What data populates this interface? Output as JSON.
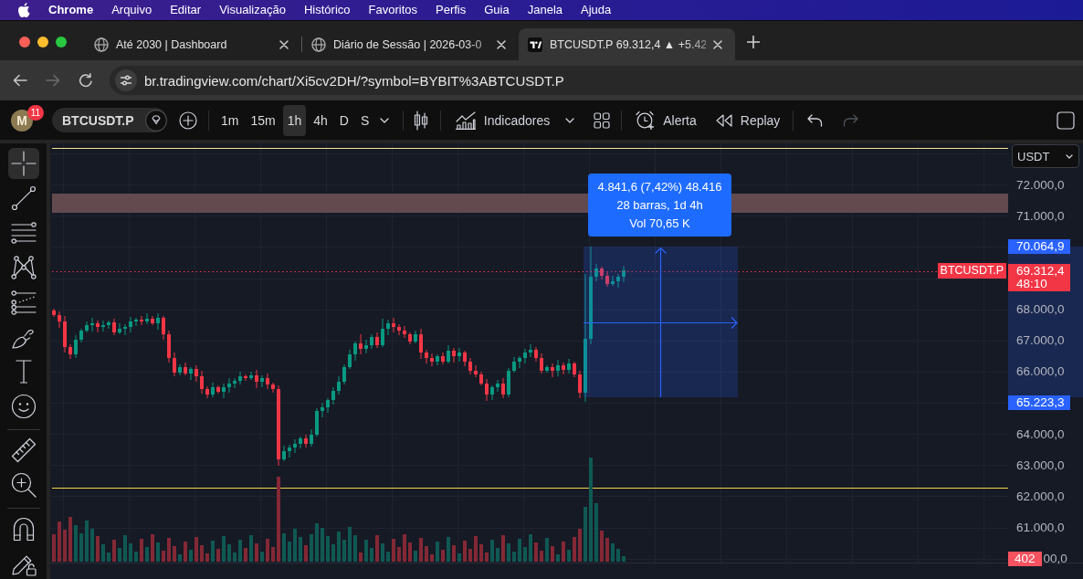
{
  "menu_bar": {
    "app_name": "Chrome",
    "items": [
      "Arquivo",
      "Editar",
      "Visualização",
      "Histórico",
      "Favoritos",
      "Perfis",
      "Guia",
      "Janela",
      "Ajuda"
    ]
  },
  "browser": {
    "tabs": [
      {
        "kind": "site",
        "title": "Até 2030 | Dashboard",
        "selected": false
      },
      {
        "kind": "site",
        "title": "Diário de Sessão | 2026-03-0",
        "selected": false
      },
      {
        "kind": "tradingview",
        "title": "BTCUSDT.P 69.312,4 ▲ +5.42",
        "selected": true
      }
    ],
    "nav_buttons": [
      {
        "kind": "back",
        "disabled": false
      },
      {
        "kind": "forward",
        "disabled": true
      },
      {
        "kind": "reload",
        "disabled": false
      }
    ],
    "address": "br.tradingview.com/chart/Xi5cv2DH/?symbol=BYBIT%3ABTCUSDT.P"
  },
  "top_toolbar": {
    "avatar": {
      "initial": "M",
      "badge": "11"
    },
    "symbol": "BTCUSDT.P",
    "intervals": [
      {
        "label": "1m",
        "selected": false
      },
      {
        "label": "15m",
        "selected": false
      },
      {
        "label": "1h",
        "selected": true
      },
      {
        "label": "4h",
        "selected": false
      },
      {
        "label": "D",
        "selected": false
      },
      {
        "label": "S",
        "selected": false
      }
    ],
    "items": [
      {
        "kind": "indicators",
        "label": "Indicadores"
      },
      {
        "kind": "alert",
        "label": "Alerta"
      },
      {
        "kind": "replay",
        "label": "Replay"
      }
    ],
    "history": [
      {
        "kind": "undo",
        "disabled": false
      },
      {
        "kind": "redo",
        "disabled": true
      }
    ]
  },
  "drawing_tools": [
    {
      "tools": [
        {
          "kind": "crosshair",
          "selected": true
        },
        {
          "kind": "trend_line",
          "selected": false
        },
        {
          "kind": "fib_lines",
          "selected": false
        },
        {
          "kind": "pattern",
          "selected": false
        },
        {
          "kind": "projection",
          "selected": false
        },
        {
          "kind": "brush",
          "selected": false
        },
        {
          "kind": "text",
          "selected": false
        },
        {
          "kind": "emoji",
          "selected": false
        }
      ]
    },
    {
      "tools": [
        {
          "kind": "ruler",
          "selected": false
        },
        {
          "kind": "zoom",
          "selected": false
        }
      ]
    },
    {
      "tools": [
        {
          "kind": "magnet",
          "selected": false
        },
        {
          "kind": "lock",
          "selected": false
        }
      ]
    }
  ],
  "chart": {
    "currency": "USDT",
    "symbol_label": "BTCUSDT.P",
    "measure_tooltip": [
      "4.841,6 (7,42%) 48.416",
      "28 barras, 1d 4h",
      "Vol 70,65 K"
    ],
    "price_axis": [
      {
        "kind": "tick",
        "label": "72.000,0"
      },
      {
        "kind": "tick",
        "label": "71.000,0"
      },
      {
        "kind": "tag",
        "label": "70.064,9",
        "color": "#2962ff"
      },
      {
        "kind": "tag",
        "label": "69.312,4",
        "sublabel": "48:10",
        "color": "#f23645"
      },
      {
        "kind": "tick",
        "label": "68.000,0"
      },
      {
        "kind": "tick",
        "label": "67.000,0"
      },
      {
        "kind": "tick",
        "label": "66.000,0"
      },
      {
        "kind": "tag",
        "label": "65.223,3",
        "color": "#2962ff"
      },
      {
        "kind": "tick",
        "label": "64.000,0"
      },
      {
        "kind": "tick",
        "label": "63.000,0"
      },
      {
        "kind": "tick",
        "label": "62.000,0"
      },
      {
        "kind": "tick",
        "label": "61.000,0"
      },
      {
        "kind": "tag",
        "label": "402",
        "color": "#f7525f",
        "covered_label": "00,0"
      }
    ]
  }
}
